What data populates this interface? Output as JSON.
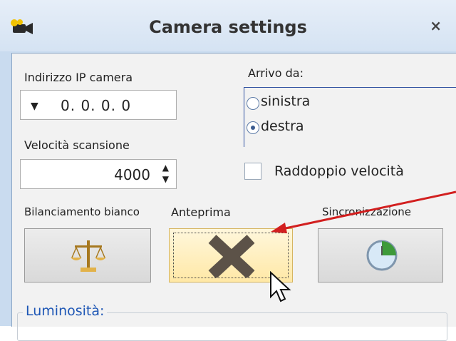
{
  "window": {
    "title": "Camera settings",
    "close_symbol": "×"
  },
  "camera_ip": {
    "label": "Indirizzo IP camera",
    "value": "0. 0. 0. 0"
  },
  "scan_speed": {
    "label": "Velocità scansione",
    "value": "4000"
  },
  "arrival": {
    "label": "Arrivo da:",
    "options": [
      {
        "label": "sinistra",
        "selected": false
      },
      {
        "label": "destra",
        "selected": true
      }
    ]
  },
  "double_speed": {
    "label": "Raddoppio velocità",
    "checked": false
  },
  "buttons": {
    "white_balance": "Bilanciamento bianco",
    "preview": "Anteprima",
    "sync": "Sincronizzazione"
  },
  "brightness": {
    "label": "Luminosità:"
  },
  "colors": {
    "accent_blue": "#1d56b5",
    "annotation_red": "#d21f1f",
    "preview_highlight": "#ffe8a6"
  },
  "icons": [
    "camera-app-icon",
    "close-icon",
    "dropdown-arrow-icon",
    "spin-up-icon",
    "spin-down-icon",
    "scale-icon",
    "stop-x-icon",
    "sync-clock-icon",
    "mouse-cursor-icon",
    "annotation-arrow"
  ]
}
